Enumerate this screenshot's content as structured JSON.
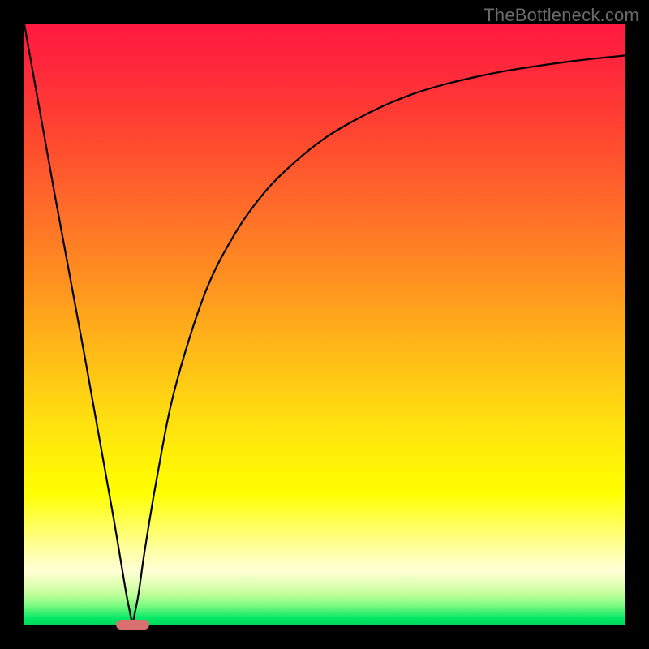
{
  "watermark": "TheBottleneck.com",
  "chart_data": {
    "type": "line",
    "title": "",
    "xlabel": "",
    "ylabel": "",
    "xlim": [
      0,
      100
    ],
    "ylim": [
      0,
      100
    ],
    "grid": false,
    "legend": null,
    "optimum_x": 18,
    "series": [
      {
        "name": "bottleneck-curve",
        "x": [
          0,
          5,
          10,
          15,
          17,
          18,
          19,
          20,
          22,
          25,
          30,
          35,
          40,
          45,
          50,
          55,
          60,
          65,
          70,
          75,
          80,
          85,
          90,
          95,
          100
        ],
        "values": [
          100,
          72,
          45,
          17,
          5,
          0,
          5,
          12,
          24,
          39,
          55,
          65,
          72,
          77,
          81,
          84,
          86.5,
          88.5,
          90,
          91.2,
          92.2,
          93,
          93.7,
          94.3,
          94.8
        ]
      }
    ],
    "marker": {
      "shape": "pill",
      "x": 18,
      "y": 0,
      "width_pct": 5.5,
      "height_pct": 1.5,
      "color": "#d97070"
    },
    "background_gradient": {
      "top": "#ff1a3f",
      "mid": "#ffff00",
      "bottom": "#00d859"
    }
  }
}
